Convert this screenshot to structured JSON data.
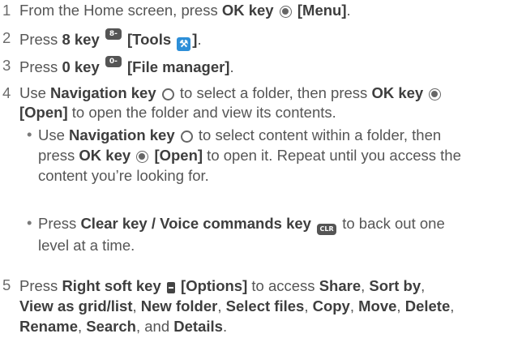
{
  "icons": {
    "ok_key": "ok-key-icon",
    "key_8": "8-tuv",
    "tools": "tools-icon",
    "key_0": "0-next",
    "navigation_key": "navigation-key-icon",
    "clr_key": "CLR",
    "right_soft_key": "right-soft-key-icon"
  },
  "steps": [
    {
      "number": "1",
      "text1": "From the Home screen, press ",
      "b1": "OK key",
      "b2": "[Menu]",
      "text2": "."
    },
    {
      "number": "2",
      "text1": "Press ",
      "b1": "8 key",
      "b2": "[Tools",
      "b3": "]",
      "text2": "."
    },
    {
      "number": "3",
      "text1": "Press ",
      "b1": "0 key",
      "b2": "[File manager]",
      "text2": "."
    },
    {
      "number": "4",
      "text1": "Use ",
      "b1": "Navigation key",
      "text2": " to select a folder, then press ",
      "b2": "OK key",
      "line2_b": "[Open]",
      "line2_t": " to open the folder and view its contents.",
      "bullets": [
        {
          "l1_t1": "Use ",
          "l1_b1": "Navigation key",
          "l1_t2": " to select content within a folder, then",
          "l2_t1": "press ",
          "l2_b1": "OK key",
          "l2_b2": "[Open]",
          "l2_t2": " to open it. Repeat until you access the",
          "l3": "content you’re looking for."
        },
        {
          "l1_t1": "Press ",
          "l1_b1": "Clear key / Voice commands key",
          "l1_t2": " to back out one",
          "l2": "level at a time."
        }
      ]
    },
    {
      "number": "5",
      "l1_t1": "Press ",
      "l1_b1": "Right soft key",
      "l1_b2": "[Options]",
      "l1_t2": " to access ",
      "l1_b3": "Share",
      "l1_t3": ", ",
      "l1_b4": "Sort by",
      "l1_t4": ",",
      "l2_b1": "View as grid/list",
      "l2_t1": ", ",
      "l2_b2": "New folder",
      "l2_t2": ", ",
      "l2_b3": "Select files",
      "l2_t3": ", ",
      "l2_b4": "Copy",
      "l2_t4": ", ",
      "l2_b5": "Move",
      "l2_t5": ", ",
      "l2_b6": "Delete",
      "l2_t6": ",",
      "l3_b1": "Rename",
      "l3_t1": ", ",
      "l3_b2": "Search",
      "l3_t2": ", and ",
      "l3_b3": "Details",
      "l3_t3": "."
    }
  ]
}
